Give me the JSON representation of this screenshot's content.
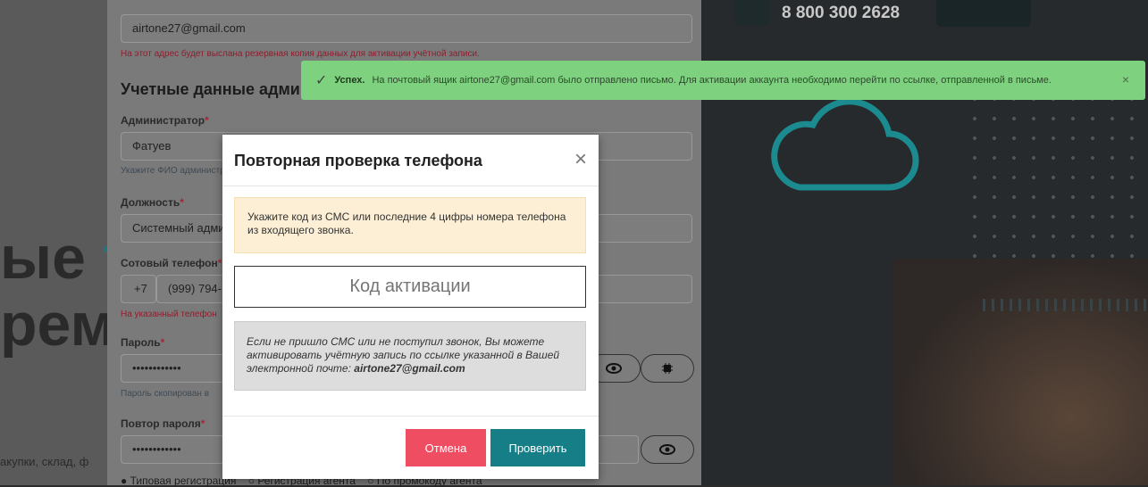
{
  "form": {
    "email_value": "airtone27@gmail.com",
    "email_hint": "На этот адрес будет выслана резервная копия данных для активации учётной записи.",
    "section_title": "Учетные данные администратора системы",
    "admin_label": "Администратор",
    "admin_value": "Фатуев",
    "admin_hint": "Укажите ФИО администратора",
    "position_label": "Должность",
    "position_value": "Системный администратор",
    "phone_label": "Сотовый телефон",
    "phone_prefix": "+7",
    "phone_value": "(999) 794-",
    "phone_hint": "На указанный телефон",
    "password_label": "Пароль",
    "password_value": "••••••••••••",
    "password_hint": "Пароль скопирован в",
    "password_repeat_label": "Повтор пароля",
    "password_repeat_value": "••••••••••••",
    "required_mark": "*",
    "reg_options": [
      "Типовая регистрация",
      "Регистрация агента",
      "По промокоду агента"
    ]
  },
  "background": {
    "hero_line1a": "ые ",
    "hero_line1b": "т",
    "hero_line2": "рем",
    "hero_bottom": "акупки, склад, ф",
    "phone_number": "8 800 300 2628"
  },
  "toast": {
    "title": "Успех.",
    "message": "На почтовый ящик airtone27@gmail.com было отправлено письмо. Для активации аккаунта необходимо перейти по ссылке, отправленной в письме.",
    "close": "×"
  },
  "modal": {
    "title": "Повторная проверка телефона",
    "close": "×",
    "notice": "Укажите код из СМС или последние 4 цифры номера телефона из входящего звонка.",
    "code_placeholder": "Код активации",
    "info_text": "Если не пришло СМС или не поступил звонок, Вы можете активировать учётную запись по ссылке указанной в Вашей электронной почте: ",
    "info_email": "airtone27@gmail.com",
    "cancel_label": "Отмена",
    "check_label": "Проверить"
  },
  "colors": {
    "toast_bg": "#7ed17e",
    "cancel_bg": "#ef4d62",
    "check_bg": "#157e86",
    "notice_bg": "#fcefd6"
  }
}
